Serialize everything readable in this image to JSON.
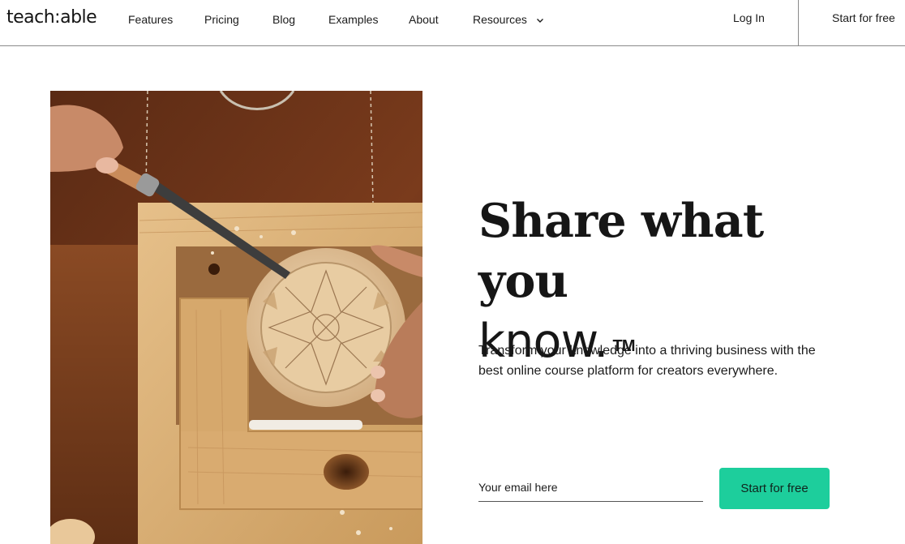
{
  "header": {
    "logo": "teach:able",
    "nav": [
      {
        "label": "Features"
      },
      {
        "label": "Pricing"
      },
      {
        "label": "Blog"
      },
      {
        "label": "Examples"
      },
      {
        "label": "About"
      },
      {
        "label": "Resources"
      }
    ],
    "login_label": "Log In",
    "start_label": "Start for free"
  },
  "hero": {
    "headline_line1": "Share what you",
    "headline_line2": "know.",
    "trademark": "TM",
    "subtitle": "Transform your knowledge into a thriving business with the best online course platform for creators everywhere.",
    "email_placeholder": "Your email here",
    "cta_label": "Start for free",
    "image_subject": "woodcarver-chiseling-bowl-photo"
  },
  "colors": {
    "accent": "#1dce9c",
    "text": "#1b1b1b",
    "divider": "#8a8a8a"
  },
  "icons": {
    "resources_dropdown": "chevron-down-icon"
  }
}
